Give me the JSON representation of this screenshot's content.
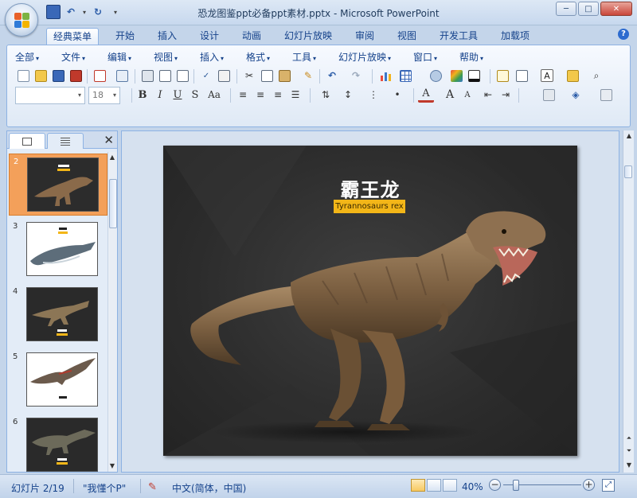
{
  "window": {
    "title": "恐龙图鉴ppt必备ppt素材.pptx - Microsoft PowerPoint",
    "minimize": "─",
    "maximize": "□",
    "close": "✕"
  },
  "ribbon_tabs": [
    "经典菜单",
    "开始",
    "插入",
    "设计",
    "动画",
    "幻灯片放映",
    "审阅",
    "视图",
    "开发工具",
    "加载项"
  ],
  "active_tab": "经典菜单",
  "menu": [
    "全部",
    "文件",
    "编辑",
    "视图",
    "插入",
    "格式",
    "工具",
    "幻灯片放映",
    "窗口",
    "帮助"
  ],
  "font": {
    "name": "",
    "size": "18"
  },
  "format_buttons": {
    "bold": "B",
    "italic": "I",
    "underline": "U",
    "strike": "S",
    "case": "Aa",
    "color": "A",
    "grow": "A",
    "shrink": "A"
  },
  "panel": {
    "close_label": "✕"
  },
  "thumbnails": [
    {
      "num": "2",
      "selected": true,
      "bg": "#2c2c2c"
    },
    {
      "num": "3",
      "selected": false,
      "bg": "#ffffff"
    },
    {
      "num": "4",
      "selected": false,
      "bg": "#2a2a2a"
    },
    {
      "num": "5",
      "selected": false,
      "bg": "#ffffff"
    },
    {
      "num": "6",
      "selected": false,
      "bg": "#2a2a2a"
    }
  ],
  "slide": {
    "title": "霸王龙",
    "subtitle": "Tyrannosaurs rex",
    "accent": "#f3b618"
  },
  "status": {
    "slide_info": "幻灯片 2/19",
    "theme": "\"我懂个P\"",
    "language": "中文(简体，中国)",
    "zoom": "40%",
    "zoom_fraction": 0.4
  },
  "icons": [
    "save-icon",
    "undo-icon",
    "redo-icon",
    "help-icon",
    "new-icon",
    "open-icon",
    "print-icon",
    "cut-icon",
    "copy-icon",
    "paste-icon",
    "chart-icon",
    "table-icon",
    "close-icon",
    "zoom-in-icon",
    "zoom-out-icon",
    "fit-window-icon"
  ]
}
